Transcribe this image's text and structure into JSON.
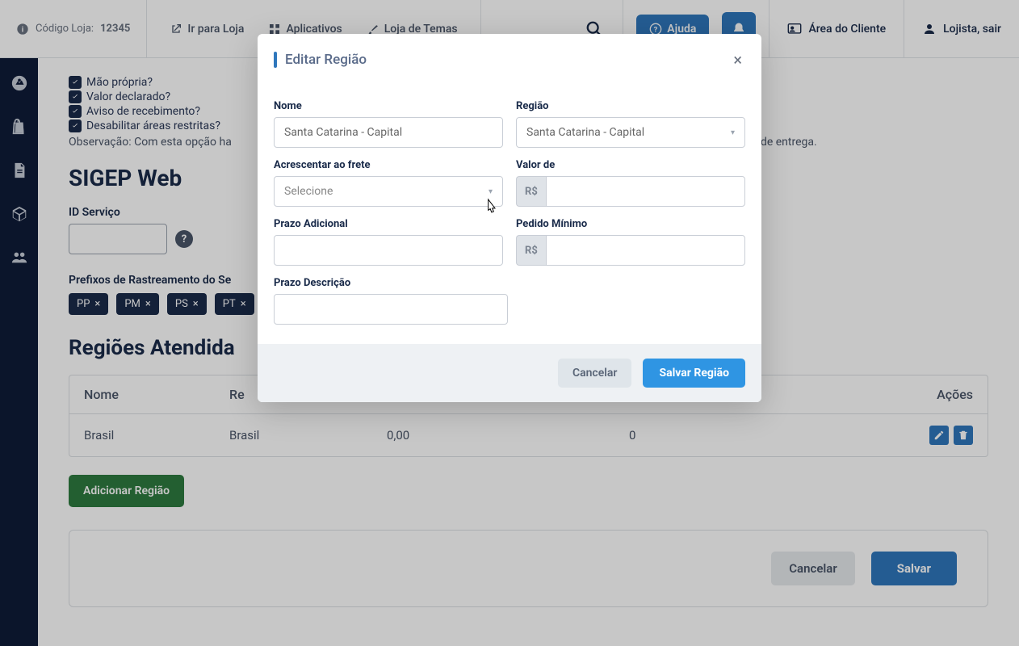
{
  "header": {
    "store_code_label": "Código Loja:",
    "store_code_value": "12345",
    "go_to_store": "Ir para Loja",
    "apps": "Aplicativos",
    "theme_store": "Loja de Temas",
    "help": "Ajuda",
    "client_area": "Área do Cliente",
    "logout": "Lojista, sair"
  },
  "checkboxes": {
    "own_hand": "Mão própria?",
    "declared_value": "Valor declarado?",
    "receipt_notice": "Aviso de recebimento?",
    "disable_restricted": "Desabilitar áreas restritas?"
  },
  "note": "Observação: Com esta opção ha",
  "note_tail": "iais de entrega.",
  "section_title": "SIGEP Web",
  "service_id_label": "ID Serviço",
  "tracking_prefix_label": "Prefixos de Rastreamento do Se",
  "tags": [
    "PP",
    "PM",
    "PS",
    "PT"
  ],
  "regions_title": "Regiões Atendida",
  "table": {
    "headers": {
      "nome": "Nome",
      "regiao": "Re",
      "acoes": "Ações"
    },
    "rows": [
      {
        "nome": "Brasil",
        "regiao": "Brasil",
        "acrescentar": "0,00",
        "pedido_minimo": "0"
      }
    ]
  },
  "add_region": "Adicionar Região",
  "footer": {
    "cancel": "Cancelar",
    "save": "Salvar"
  },
  "modal": {
    "title": "Editar Região",
    "labels": {
      "nome": "Nome",
      "regiao": "Região",
      "acrescentar": "Acrescentar ao frete",
      "valor_de": "Valor de",
      "prazo_adicional": "Prazo Adicional",
      "pedido_minimo": "Pedido Mínimo",
      "prazo_descricao": "Prazo Descrição"
    },
    "values": {
      "nome": "Santa Catarina - Capital",
      "regiao": "Santa Catarina - Capital",
      "acrescentar_placeholder": "Selecione",
      "currency_prefix": "R$"
    },
    "footer": {
      "cancel": "Cancelar",
      "save": "Salvar Região"
    }
  }
}
